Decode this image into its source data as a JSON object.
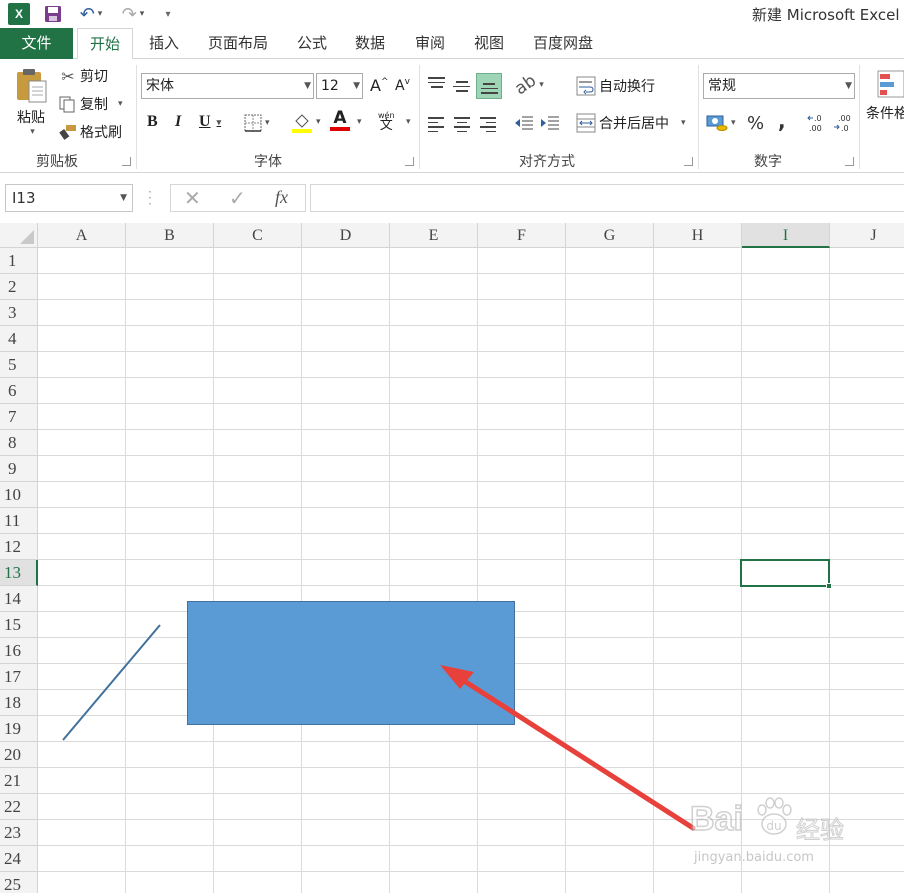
{
  "app": {
    "window_title": "新建 Microsoft Excel",
    "logo_text": "X"
  },
  "tabs": [
    {
      "label": "文件"
    },
    {
      "label": "开始"
    },
    {
      "label": "插入"
    },
    {
      "label": "页面布局"
    },
    {
      "label": "公式"
    },
    {
      "label": "数据"
    },
    {
      "label": "审阅"
    },
    {
      "label": "视图"
    },
    {
      "label": "百度网盘"
    }
  ],
  "ribbon": {
    "clipboard": {
      "paste": "粘贴",
      "cut": "剪切",
      "copy": "复制",
      "format_painter": "格式刷",
      "group_label": "剪贴板"
    },
    "font": {
      "font_name": "宋体",
      "font_size": "12",
      "bold": "B",
      "italic": "I",
      "underline": "U",
      "font_color_glyph": "A",
      "grow": "A",
      "shrink": "A",
      "phonetic": "文",
      "group_label": "字体"
    },
    "alignment": {
      "wrap_text": "自动换行",
      "merge_center": "合并后居中",
      "group_label": "对齐方式"
    },
    "number": {
      "format": "常规",
      "percent": "%",
      "comma": ",",
      "group_label": "数字"
    },
    "styles": {
      "conditional_format": "条件格"
    }
  },
  "formula_bar": {
    "name_box": "I13",
    "fx": "fx",
    "value": ""
  },
  "grid": {
    "columns": [
      "A",
      "B",
      "C",
      "D",
      "E",
      "F",
      "G",
      "H",
      "I",
      "J"
    ],
    "rows": [
      "1",
      "2",
      "3",
      "4",
      "5",
      "6",
      "7",
      "8",
      "9",
      "10",
      "11",
      "12",
      "13",
      "14",
      "15",
      "16",
      "17",
      "18",
      "19",
      "20",
      "21",
      "22",
      "23",
      "24",
      "25"
    ],
    "selected_column": "I",
    "selected_row": "13"
  },
  "watermark": {
    "brand": "Bai",
    "product": "经验",
    "url": "jingyan.baidu.com"
  },
  "colors": {
    "accent": "#217346",
    "shape_fill": "#5b9bd5",
    "shape_border": "#41719c",
    "line": "#41719c",
    "arrow": "#e8403a"
  }
}
